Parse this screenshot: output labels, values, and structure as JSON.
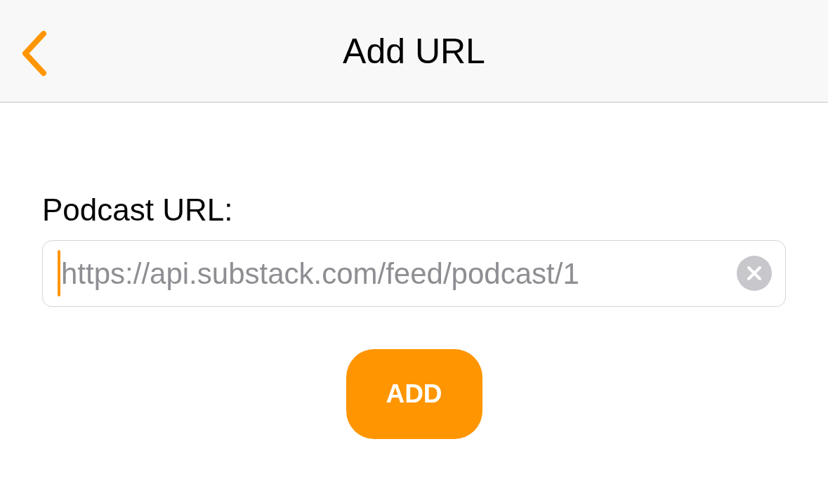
{
  "nav_bar": {
    "title": "Add URL"
  },
  "form": {
    "label": "Podcast URL:",
    "url_field": {
      "placeholder": "https://api.substack.com/feed/podcast/1",
      "focused": true
    },
    "add_button": "ADD"
  }
}
